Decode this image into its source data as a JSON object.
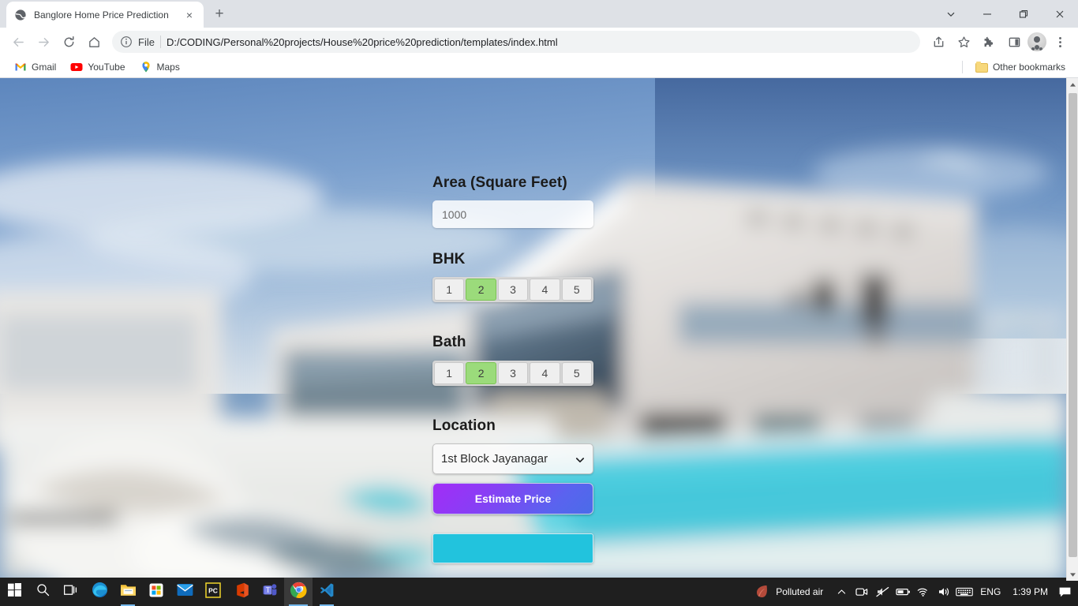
{
  "browser": {
    "tab": {
      "title": "Banglore Home Price Prediction",
      "favicon": "globe-icon",
      "close": "×"
    },
    "new_tab_label": "+",
    "window_controls": {
      "tab_search": "tab-search-chevron-icon",
      "minimize": "minimize-icon",
      "maximize": "maximize-icon",
      "close": "close-icon"
    },
    "nav": {
      "back": "back-arrow-icon",
      "forward": "forward-arrow-icon",
      "reload": "reload-icon",
      "home": "home-icon"
    },
    "omnibox": {
      "info_icon": "info-circle-icon",
      "scheme_label": "File",
      "url": "D:/CODING/Personal%20projects/House%20price%20prediction/templates/index.html"
    },
    "actions": {
      "share": "share-icon",
      "bookmark": "star-icon",
      "extensions": "puzzle-icon",
      "side_panel": "side-panel-icon",
      "profile": "avatar-icon",
      "menu": "three-dots-menu-icon"
    },
    "bookmarks": [
      {
        "label": "Gmail",
        "icon": "gmail-icon"
      },
      {
        "label": "YouTube",
        "icon": "youtube-icon"
      },
      {
        "label": "Maps",
        "icon": "maps-pin-icon"
      }
    ],
    "other_bookmarks": {
      "label": "Other bookmarks",
      "icon": "folder-icon"
    }
  },
  "page": {
    "area": {
      "label": "Area (Square Feet)",
      "value": "1000",
      "placeholder": "1000"
    },
    "bhk": {
      "label": "BHK",
      "options": [
        "1",
        "2",
        "3",
        "4",
        "5"
      ],
      "selected": "2"
    },
    "bath": {
      "label": "Bath",
      "options": [
        "1",
        "2",
        "3",
        "4",
        "5"
      ],
      "selected": "2"
    },
    "location": {
      "label": "Location",
      "selected": "1st Block Jayanagar",
      "chevron": "chevron-down-icon"
    },
    "estimate_button": "Estimate Price",
    "result": "",
    "colors": {
      "selected_option": "#9bdb7b",
      "button_gradient_start": "#a22df7",
      "button_gradient_end": "#4a6ce8",
      "result_box": "#22c3dd"
    }
  },
  "taskbar": {
    "items": [
      {
        "name": "start-button",
        "icon": "windows-logo-icon"
      },
      {
        "name": "search-button",
        "icon": "search-icon"
      },
      {
        "name": "task-view-button",
        "icon": "task-view-icon"
      },
      {
        "name": "edge-button",
        "icon": "edge-icon"
      },
      {
        "name": "file-explorer-button",
        "icon": "folder-icon"
      },
      {
        "name": "microsoft-store-button",
        "icon": "store-icon"
      },
      {
        "name": "mail-button",
        "icon": "mail-icon"
      },
      {
        "name": "pycharm-button",
        "icon": "pycharm-icon"
      },
      {
        "name": "office-button",
        "icon": "office-icon"
      },
      {
        "name": "teams-button",
        "icon": "teams-icon"
      },
      {
        "name": "chrome-button",
        "icon": "chrome-icon"
      },
      {
        "name": "vscode-button",
        "icon": "vscode-icon"
      }
    ],
    "tray": {
      "weather": "Polluted air",
      "weather_icon": "leaf-icon",
      "overflow": "chevron-up-icon",
      "icons": [
        "camera-icon",
        "no-sound-icon",
        "battery-icon",
        "wifi-icon",
        "volume-icon",
        "keyboard-icon"
      ],
      "language": "ENG",
      "clock": "1:39 PM",
      "notifications": "notification-icon"
    }
  }
}
